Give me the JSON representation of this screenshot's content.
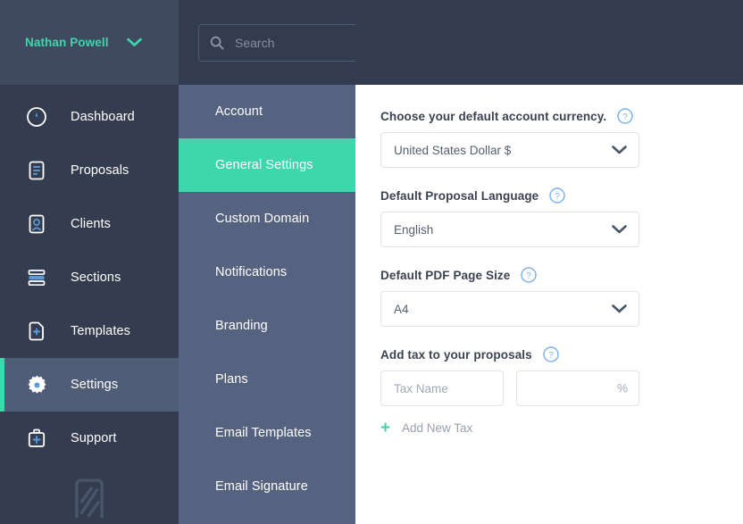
{
  "sidebar": {
    "user": {
      "name": "Nathan Powell",
      "caret_icon": "chevron-down-icon"
    },
    "items": [
      {
        "label": "Dashboard",
        "icon": "gauge-icon",
        "active": false
      },
      {
        "label": "Proposals",
        "icon": "document-lines-icon",
        "active": false
      },
      {
        "label": "Clients",
        "icon": "person-card-icon",
        "active": false
      },
      {
        "label": "Sections",
        "icon": "stacked-bars-icon",
        "active": false
      },
      {
        "label": "Templates",
        "icon": "document-plus-icon",
        "active": false
      },
      {
        "label": "Settings",
        "icon": "gear-icon",
        "active": true
      },
      {
        "label": "Support",
        "icon": "briefcase-plus-icon",
        "active": false
      }
    ],
    "logo": "n-logo-watermark"
  },
  "search": {
    "placeholder": "Search",
    "value": "",
    "icon": "search-icon"
  },
  "subnav": {
    "items": [
      {
        "label": "Account",
        "active": false
      },
      {
        "label": "General Settings",
        "active": true
      },
      {
        "label": "Custom Domain",
        "active": false
      },
      {
        "label": "Notifications",
        "active": false
      },
      {
        "label": "Branding",
        "active": false
      },
      {
        "label": "Plans",
        "active": false
      },
      {
        "label": "Email Templates",
        "active": false
      },
      {
        "label": "Email Signature",
        "active": false
      }
    ]
  },
  "main": {
    "currency": {
      "label": "Choose your default account currency.",
      "help_icon": "help-circle-icon",
      "value": "United States Dollar $",
      "caret_icon": "chevron-down-icon"
    },
    "language": {
      "label": "Default Proposal Language",
      "help_icon": "help-circle-icon",
      "value": "English",
      "caret_icon": "chevron-down-icon"
    },
    "page_size": {
      "label": "Default PDF Page Size",
      "help_icon": "help-circle-icon",
      "value": "A4",
      "caret_icon": "chevron-down-icon"
    },
    "tax": {
      "label": "Add tax to your proposals",
      "help_icon": "help-circle-icon",
      "name_placeholder": "Tax Name",
      "name_value": "",
      "rate_value": "",
      "percent_sign": "%",
      "add_new_label": "Add New Tax",
      "add_new_icon": "plus-icon"
    }
  },
  "colors": {
    "accent_teal": "#3ed6ab",
    "sidebar_dark": "#343d4f",
    "sidebar_active": "#505d77",
    "subnav_bg": "#566380",
    "icon_blue": "#5b9bd5",
    "help_blue": "#7eb3e8"
  }
}
